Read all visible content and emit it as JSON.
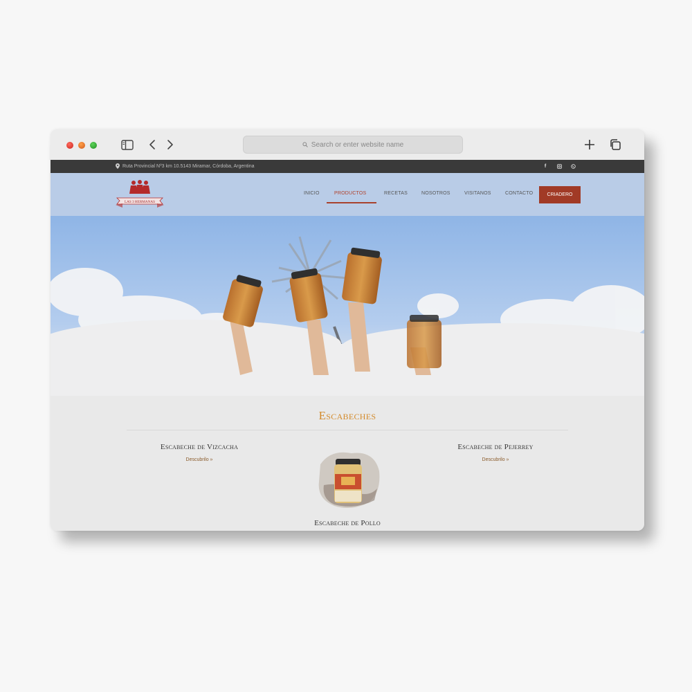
{
  "browser": {
    "url_placeholder": "Search or enter website name",
    "icons": [
      "sidebar-icon",
      "back-chevron-icon",
      "forward-chevron-icon",
      "plus-icon",
      "tabs-icon",
      "search-icon"
    ]
  },
  "topbar": {
    "address": "Ruta Provincial Nº3 km 10.5143 Miramar, Córdoba, Argentina",
    "social": [
      "f",
      "instagram-icon",
      "whatsapp-icon"
    ]
  },
  "logo": {
    "text": "LAS 3 HERMANAS"
  },
  "nav": {
    "items": [
      {
        "label": "INICIO"
      },
      {
        "label": "PRODUCTOS",
        "active": true
      },
      {
        "label": "RECETAS"
      },
      {
        "label": "NOSOTROS"
      },
      {
        "label": "VISITANOS"
      },
      {
        "label": "CONTACTO"
      }
    ],
    "cta": "CRIADERO"
  },
  "section": {
    "title": "Escabeches",
    "products": [
      {
        "name": "Escabeche de Vizcacha",
        "link": "Descubrilo »"
      },
      {
        "name": "Escabeche de Pejerrey",
        "link": "Descubrilo »"
      },
      {
        "name": "Escabeche de Pollo"
      }
    ]
  },
  "colors": {
    "accent": "#a13a26",
    "title": "#d38a2a",
    "header_bg": "#b9cce7",
    "topbar_bg": "#3a3a3a"
  }
}
